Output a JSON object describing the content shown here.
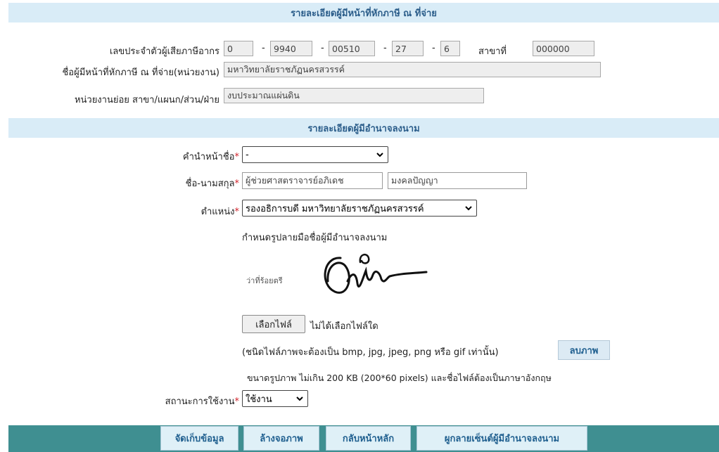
{
  "section1": {
    "title": "รายละเอียดผู้มีหน้าที่หักภาษี ณ ที่จ่าย",
    "tax_id_label": "เลขประจำตัวผู้เสียภาษีอากร",
    "tax_id_parts": [
      "0",
      "9940",
      "00510",
      "27",
      "6"
    ],
    "branch_label": "สาขาที่",
    "branch_value": "000000",
    "payer_name_label": "ชื่อผู้มีหน้าที่หักภาษี ณ ที่จ่าย(หน่วยงาน)",
    "payer_name_value": "มหาวิทยาลัยราชภัฏนครสวรรค์",
    "subunit_label": "หน่วยงานย่อย สาขา/แผนก/ส่วน/ฝ่าย",
    "subunit_value": "งบประมาณแผ่นดิน"
  },
  "section2": {
    "title": "รายละเอียดผู้มีอำนาจลงนาม",
    "prefix_label": "คำนำหน้าชื่อ",
    "prefix_value": "-",
    "name_label": "ชื่อ-นามสกุล",
    "first_name": "ผู้ช่วยศาสตราจารย์อภิเดช",
    "last_name": "มงคลปัญญา",
    "position_label": "ตำแหน่ง",
    "position_value": "รองอธิการบดี มหาวิทยาลัยราชภัฏนครสวรรค์",
    "signature_title": "กำหนดรูปลายมือชื่อผู้มีอำนาจลงนาม",
    "signature_caption": "ว่าที่ร้อยตรี",
    "choose_file_label": "เลือกไฟล์",
    "no_file_text": "ไม่ได้เลือกไฟล์ใด",
    "file_types_note": "(ชนิดไฟล์ภาพจะต้องเป็น bmp, jpg, jpeg, png หรือ gif เท่านั้น)",
    "delete_image_label": "ลบภาพ",
    "size_note": "ขนาดรูปภาพ ไม่เกิน 200 KB (200*60 pixels) และชื่อไฟล์ต้องเป็นภาษาอังกฤษ",
    "status_label": "สถานะการใช้งาน",
    "status_value": "ใช้งาน"
  },
  "required_mark": "*",
  "footer": {
    "save_label": "จัดเก็บข้อมูล",
    "clear_label": "ล้างจอภาพ",
    "home_label": "กลับหน้าหลัก",
    "bind_signer_label": "ผูกลายเซ็นต์ผู้มีอำนาจลงนาม"
  },
  "icons": {
    "dropdown": "chevron-down-icon"
  },
  "colors": {
    "header_bg": "#d9ecf7",
    "header_text": "#2b5d8a",
    "footer_bg": "#3f8f91",
    "required": "#d2242c"
  }
}
